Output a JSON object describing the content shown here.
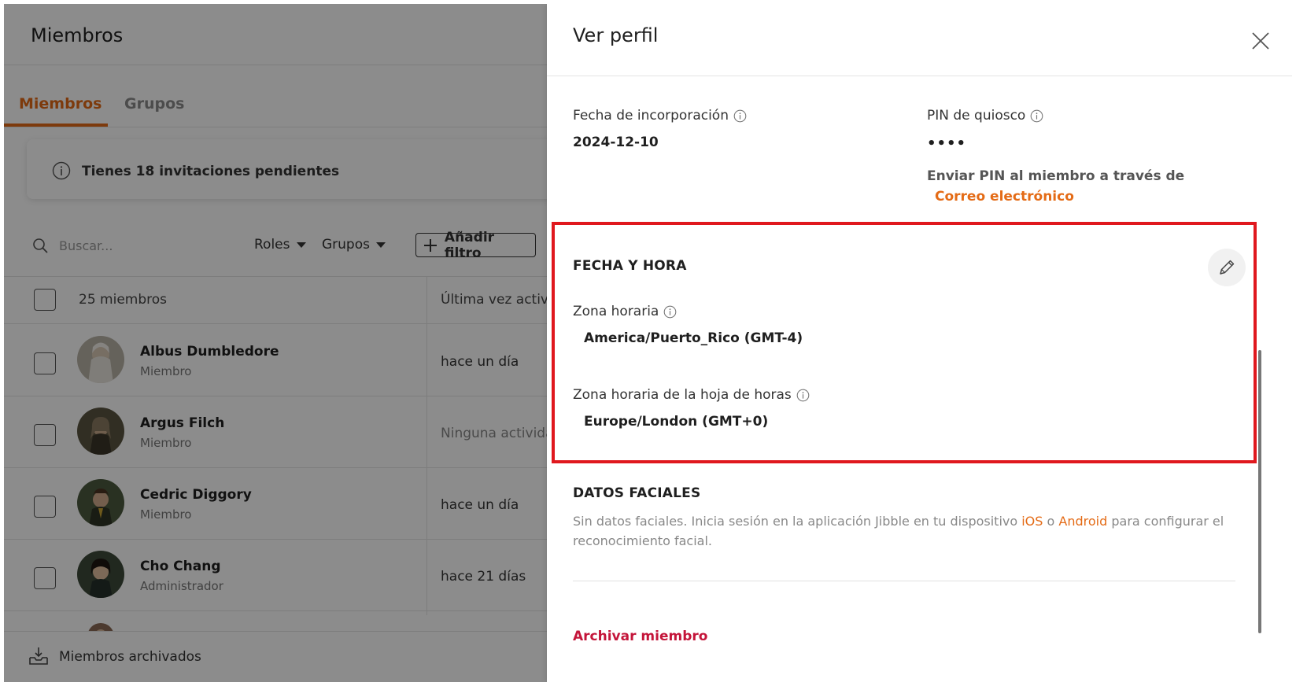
{
  "left": {
    "page_title": "Miembros",
    "tabs": [
      {
        "label": "Miembros",
        "active": true
      },
      {
        "label": "Grupos",
        "active": false
      }
    ],
    "banner_text": "Tienes 18 invitaciones pendientes",
    "search_placeholder": "Buscar...",
    "filters": {
      "roles": "Roles",
      "groups": "Grupos",
      "add_filter": "Añadir filtro"
    },
    "table": {
      "count_label": "25 miembros",
      "last_active_header": "Última vez activo"
    },
    "members": [
      {
        "name": "Albus Dumbledore",
        "role": "Miembro",
        "last_active": "hace un día",
        "muted": false
      },
      {
        "name": "Argus Filch",
        "role": "Miembro",
        "last_active": "Ninguna actividad",
        "muted": true
      },
      {
        "name": "Cedric Diggory",
        "role": "Miembro",
        "last_active": "hace un día",
        "muted": false
      },
      {
        "name": "Cho Chang",
        "role": "Administrador",
        "last_active": "hace 21 días",
        "muted": false
      }
    ],
    "archived_label": "Miembros archivados"
  },
  "panel": {
    "title": "Ver perfil",
    "join_date": {
      "label": "Fecha de incorporación",
      "value": "2024-12-10"
    },
    "kiosk_pin": {
      "label": "PIN de quiosco",
      "value": "••••"
    },
    "send_pin_text": "Enviar PIN al miembro a través de",
    "send_pin_link": "Correo electrónico",
    "datetime": {
      "section_title": "FECHA Y HORA",
      "timezone_label": "Zona horaria",
      "timezone_value": "America/Puerto_Rico (GMT-4)",
      "timesheet_tz_label": "Zona horaria de la hoja de horas",
      "timesheet_tz_value": "Europe/London (GMT+0)"
    },
    "facial": {
      "section_title": "DATOS FACIALES",
      "text_before": "Sin datos faciales. Inicia sesión en la aplicación Jibble en tu dispositivo ",
      "ios": "iOS",
      "or": " o ",
      "android": "Android",
      "text_after": " para configurar el reconocimiento facial."
    },
    "archive_member": "Archivar miembro"
  },
  "colors": {
    "accent": "#e46b16",
    "highlight": "#e0181e",
    "danger": "#c4153a",
    "overlay": "rgba(0,0,0,0.45)"
  },
  "icons": [
    "info-icon",
    "search-icon",
    "plus-icon",
    "archive-icon",
    "close-icon",
    "pencil-icon"
  ]
}
